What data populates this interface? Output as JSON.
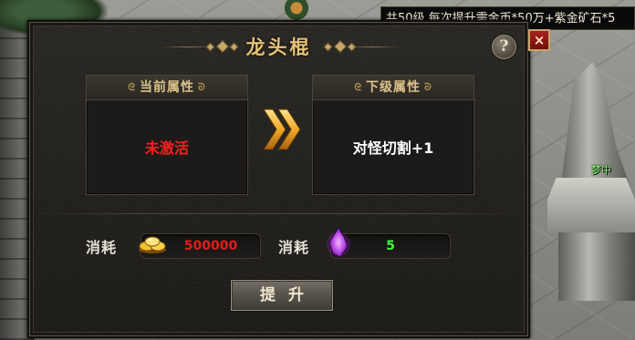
{
  "world": {
    "quest_tip": "共50级,每次提升需金币*50万+紫金矿石*5",
    "npc_name": "梦中"
  },
  "dialog": {
    "title": "龙头棍",
    "help_label": "?",
    "close_label": "×",
    "current": {
      "header": "当前属性",
      "value": "未激活"
    },
    "next": {
      "header": "下级属性",
      "value": "对怪切割+1"
    },
    "cost_gold": {
      "label": "消耗",
      "icon": "gold-ingot-icon",
      "value": "500000"
    },
    "cost_ore": {
      "label": "消耗",
      "icon": "purple-crystal-icon",
      "value": "5"
    },
    "upgrade_label": "提升"
  },
  "colors": {
    "title_gold": "#e5c27a",
    "inactive_red": "#ff1e1e",
    "gold_value_red": "#e81a1a",
    "ore_value_green": "#3cff3c"
  }
}
